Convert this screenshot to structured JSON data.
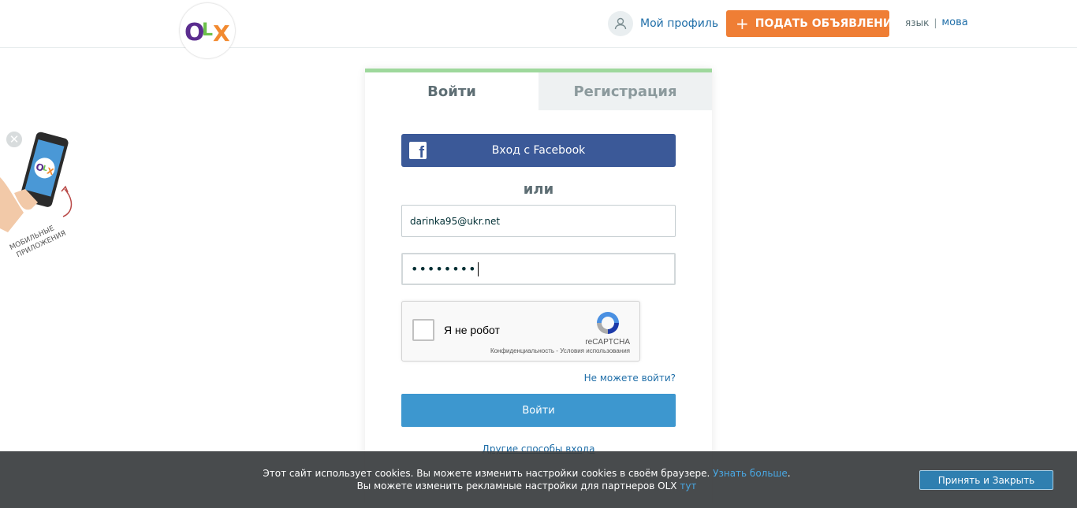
{
  "header": {
    "logo_text": "OLX",
    "profile_label": "Мой профиль",
    "post_ad_label": "ПОДАТЬ ОБЪЯВЛЕНИЕ",
    "lang_current": "язык",
    "lang_separator": "|",
    "lang_alt": "мова"
  },
  "promo": {
    "text_line1": "МОБИЛЬНЫЕ",
    "text_line2": "ПРИЛОЖЕНИЯ",
    "close_glyph": "✕"
  },
  "tabs": [
    {
      "label": "Войти",
      "active": true
    },
    {
      "label": "Регистрация",
      "active": false
    }
  ],
  "login": {
    "facebook_label": "Вход с Facebook",
    "or_label": "или",
    "email_value": "darinka95@ukr.net",
    "password_masked": "••••••••",
    "captcha_label": "Я не робот",
    "captcha_brand": "reCAPTCHA",
    "captcha_links": "Конфиденциальность - Условия использования",
    "forgot_label": "Не можете войти?",
    "submit_label": "Войти",
    "other_methods_label": "Другие способы входа"
  },
  "cookie": {
    "line1": "Этот сайт использует cookies. Вы можете изменить настройки cookies в своём браузере.",
    "line1_link": "Узнать больше",
    "line1_end": ".",
    "line2": "Вы можете изменить рекламные настройки для партнеров OLX",
    "line2_link": "тут",
    "accept_label": "Принять и Закрыть"
  },
  "colors": {
    "accent_orange": "#ef7e35",
    "facebook_blue": "#3b5998",
    "primary_blue": "#3d97cf",
    "tab_top_green": "#9ed89c",
    "link_blue": "#1f6ea8"
  }
}
